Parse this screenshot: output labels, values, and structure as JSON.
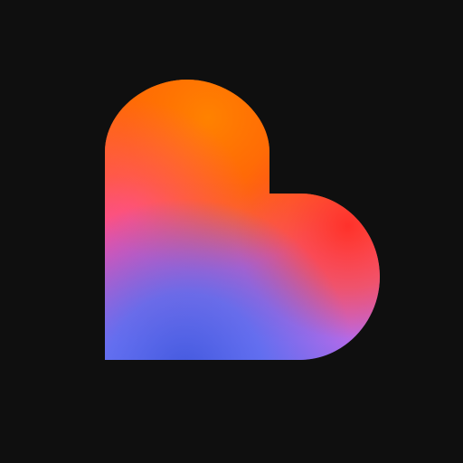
{
  "app_icon": {
    "icon": "heart-logo-icon",
    "background_color": "#0f0f0f",
    "gradient_colors": {
      "orange": "#ff7a00",
      "red_orange": "#ff3f2a",
      "pink": "#f052a9",
      "violet": "#b66ae8",
      "blue": "#4e6cf0",
      "deep_blue": "#3f58dd"
    }
  }
}
